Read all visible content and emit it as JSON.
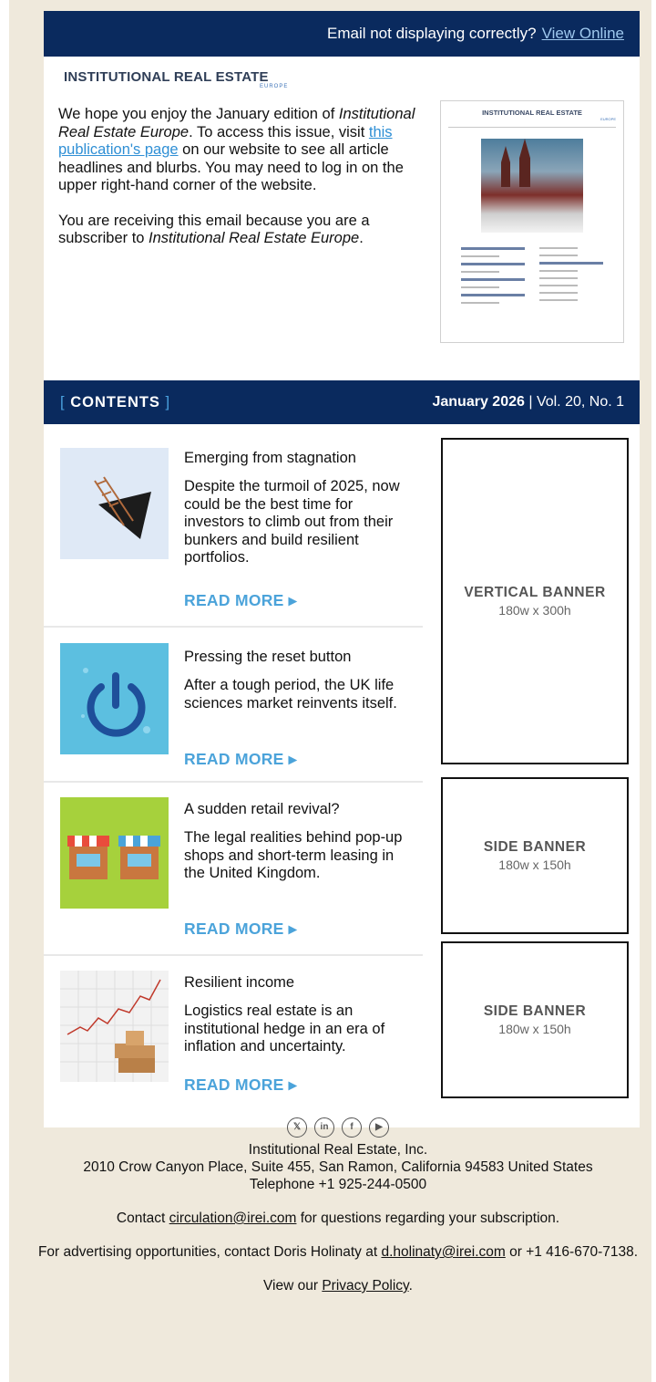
{
  "topbar": {
    "text": "Email not displaying correctly?",
    "link": "View Online"
  },
  "logo": {
    "line1": "INSTITUTIONAL REAL ESTATE",
    "line2": "EUROPE"
  },
  "intro": {
    "p1_a": "We hope you enjoy the January edition of ",
    "p1_b": "Institutional Real Estate Europe",
    "p1_c": ". To access this issue, visit ",
    "p1_link": "this publication's page",
    "p1_d": " on our website to see all article headlines and blurbs. You may need to log in on the upper right-hand corner of the website.",
    "p2_a": "You are receiving this email because you are a subscriber to ",
    "p2_b": "Institutional Real Estate Europe",
    "p2_c": "."
  },
  "cover": {
    "title": "INSTITUTIONAL REAL ESTATE",
    "sub": "EUROPE"
  },
  "contents": {
    "open": "[",
    "label": "CONTENTS",
    "close": "]",
    "date": "January 2026",
    "vol": " | Vol. 20, No. 1"
  },
  "articles": [
    {
      "title": "Emerging from stagnation",
      "desc": "Despite the turmoil of 2025, now could be the best time for investors to climb out from their bunkers and build resilient portfolios.",
      "cta": "READ MORE ▸"
    },
    {
      "title": "Pressing the reset button",
      "desc": "After a tough period, the UK life sciences market reinvents itself.",
      "cta": "READ MORE ▸"
    },
    {
      "title": "A sudden retail revival?",
      "desc": "The legal realities behind pop-up shops and short-term leasing in the United Kingdom.",
      "cta": "READ MORE ▸"
    },
    {
      "title": "Resilient income",
      "desc": "Logistics real estate is an institutional hedge in an era of inflation and uncertainty.",
      "cta": "READ MORE ▸"
    }
  ],
  "banners": [
    {
      "title": "VERTICAL BANNER",
      "size": "180w x 300h"
    },
    {
      "title": "SIDE BANNER",
      "size": "180w x 150h"
    },
    {
      "title": "SIDE BANNER",
      "size": "180w x 150h"
    }
  ],
  "social": [
    "x-icon",
    "linkedin-icon",
    "facebook-icon",
    "youtube-icon"
  ],
  "footer": {
    "company": "Institutional Real Estate, Inc.",
    "address": "2010 Crow Canyon Place, Suite 455, San Ramon, California 94583 United States",
    "phone": "Telephone +1 925-244-0500",
    "contact_a": "Contact ",
    "contact_email": "circulation@irei.com",
    "contact_b": " for questions regarding your subscription.",
    "adv_a": "For advertising opportunities, contact Doris Holinaty at ",
    "adv_email": "d.holinaty@irei.com",
    "adv_b": " or +1 416-670-7138.",
    "privacy_a": "View our ",
    "privacy_link": "Privacy Policy",
    "privacy_b": "."
  }
}
